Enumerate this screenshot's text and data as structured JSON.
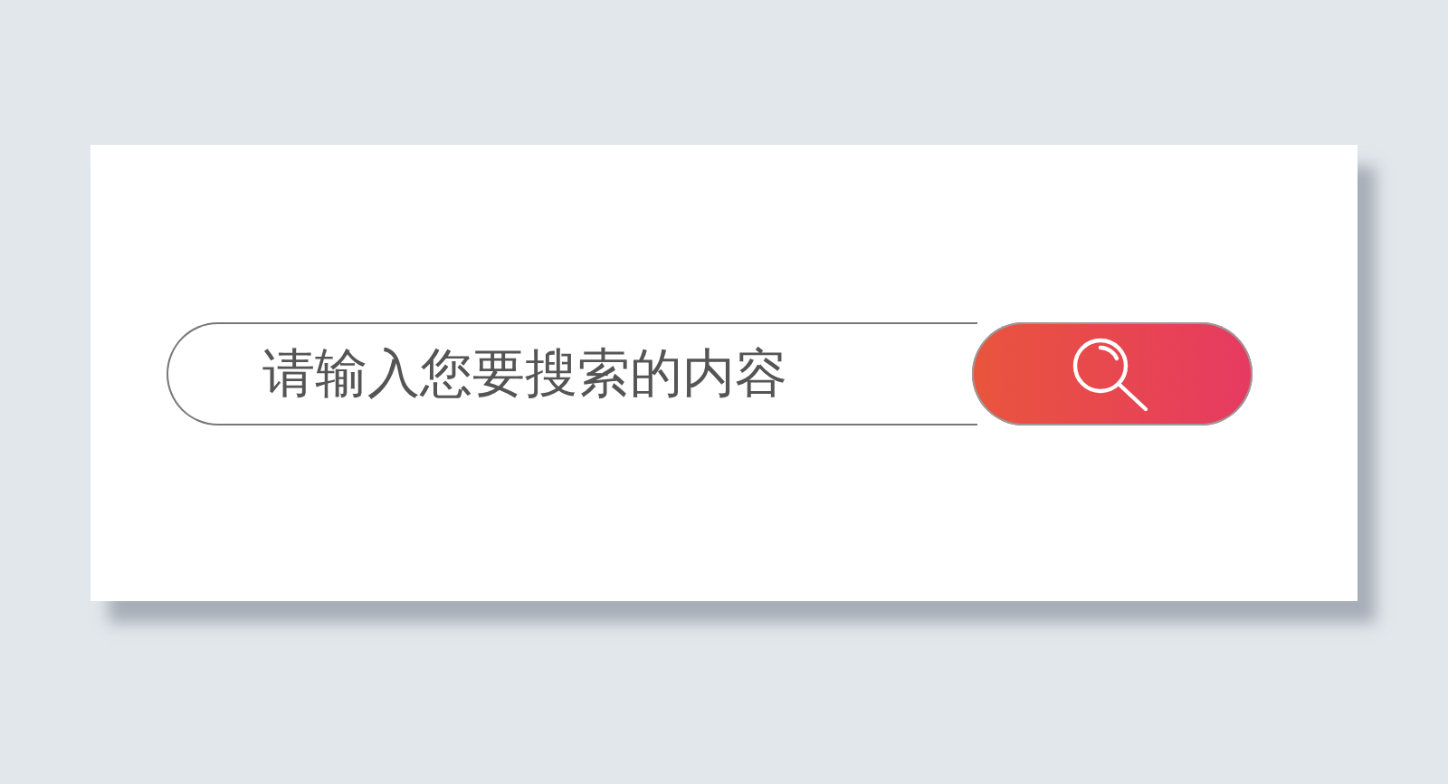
{
  "search": {
    "placeholder": "请输入您要搜索的内容"
  }
}
